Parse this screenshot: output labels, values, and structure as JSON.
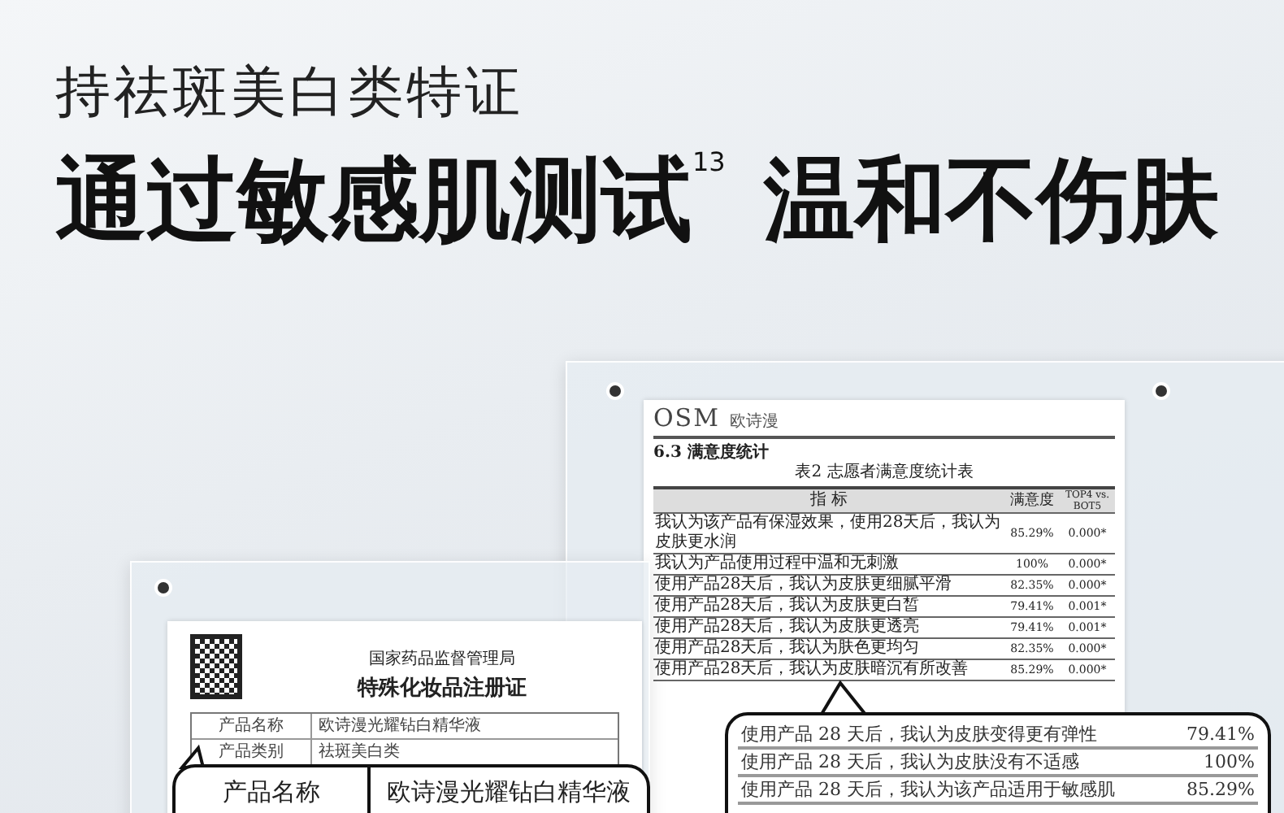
{
  "headline": {
    "subtitle": "持祛斑美白类特证",
    "title": "通过敏感肌测试$^{13}$ 温和不伤肤"
  },
  "report": {
    "logo": "OSM",
    "logo_sub": "欧诗漫",
    "section": "6.3 满意度统计",
    "caption": "表2 志愿者满意度统计表",
    "columns": [
      "指 标",
      "满意度",
      "TOP4 vs. BOT5"
    ],
    "rows": [
      {
        "item": "我认为该产品有保湿效果，使用28天后，我认为皮肤更水润",
        "rate": "85.29%",
        "p": "0.000*"
      },
      {
        "item": "我认为产品使用过程中温和无刺激",
        "rate": "100%",
        "p": "0.000*"
      },
      {
        "item": "使用产品28天后，我认为皮肤更细腻平滑",
        "rate": "82.35%",
        "p": "0.000*"
      },
      {
        "item": "使用产品28天后，我认为皮肤更白皙",
        "rate": "79.41%",
        "p": "0.001*"
      },
      {
        "item": "使用产品28天后，我认为皮肤更透亮",
        "rate": "79.41%",
        "p": "0.001*"
      },
      {
        "item": "使用产品28天后，我认为肤色更均匀",
        "rate": "82.35%",
        "p": "0.000*"
      },
      {
        "item": "使用产品28天后，我认为皮肤暗沉有所改善",
        "rate": "85.29%",
        "p": "0.000*"
      }
    ]
  },
  "certificate": {
    "agency": "国家药品监督管理局",
    "title": "特殊化妆品注册证",
    "rows": [
      {
        "label": "产品名称",
        "value": "欧诗漫光耀钻白精华液"
      },
      {
        "label": "产品类别",
        "value": "祛斑美白类"
      }
    ]
  },
  "cert_callout": {
    "label": "产品名称",
    "value": "欧诗漫光耀钻白精华液"
  },
  "report_callout": [
    {
      "item": "使用产品 28 天后，我认为皮肤变得更有弹性",
      "rate": "79.41%"
    },
    {
      "item": "使用产品 28 天后，我认为皮肤没有不适感",
      "rate": "100%"
    },
    {
      "item": "使用产品 28 天后，我认为该产品适用于敏感肌",
      "rate": "85.29%"
    }
  ]
}
